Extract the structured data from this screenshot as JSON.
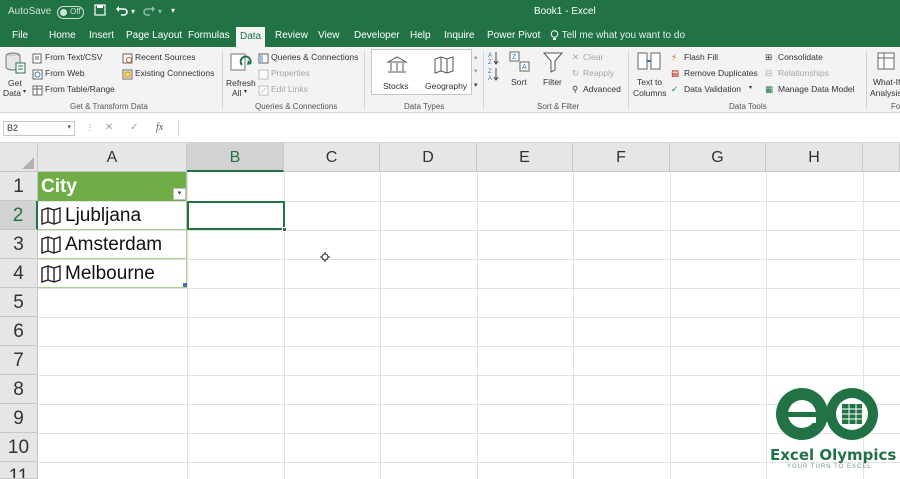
{
  "titlebar": {
    "autosave_label": "AutoSave",
    "autosave_state": "Off",
    "document_title": "Book1  -  Excel"
  },
  "ribbon_tabs": [
    "File",
    "Home",
    "Insert",
    "Page Layout",
    "Formulas",
    "Data",
    "Review",
    "View",
    "Developer",
    "Help",
    "Inquire",
    "Power Pivot"
  ],
  "active_tab": "Data",
  "tell_me": "Tell me what you want to do",
  "ribbon": {
    "get_data": "Get Data",
    "get_data_line1": "Get",
    "get_data_line2": "Data",
    "from_text_csv": "From Text/CSV",
    "from_web": "From Web",
    "from_table_range": "From Table/Range",
    "recent_sources": "Recent Sources",
    "existing_connections": "Existing Connections",
    "group_get_transform": "Get & Transform Data",
    "refresh_all_line1": "Refresh",
    "refresh_all_line2": "All",
    "queries_connections": "Queries & Connections",
    "properties": "Properties",
    "edit_links": "Edit Links",
    "group_queries": "Queries & Connections",
    "stocks": "Stocks",
    "geography": "Geography",
    "group_data_types": "Data Types",
    "sort": "Sort",
    "filter": "Filter",
    "clear": "Clear",
    "reapply": "Reapply",
    "advanced": "Advanced",
    "group_sort_filter": "Sort & Filter",
    "text_to_columns_line1": "Text to",
    "text_to_columns_line2": "Columns",
    "flash_fill": "Flash Fill",
    "remove_duplicates": "Remove Duplicates",
    "data_validation": "Data Validation",
    "consolidate": "Consolidate",
    "relationships": "Relationships",
    "manage_data_model": "Manage Data Model",
    "group_data_tools": "Data Tools",
    "what_if_line1": "What-If",
    "what_if_line2": "Analysis",
    "group_forecast": "Fo"
  },
  "formula_bar": {
    "name_box": "B2",
    "fx": "fx",
    "value": ""
  },
  "columns": [
    "A",
    "B",
    "C",
    "D",
    "E",
    "F",
    "G",
    "H"
  ],
  "rows": [
    "1",
    "2",
    "3",
    "4",
    "5",
    "6",
    "7",
    "8",
    "9",
    "10",
    "11"
  ],
  "table": {
    "header": "City",
    "cells": [
      "Ljubljana",
      "Amsterdam",
      "Melbourne"
    ]
  },
  "selected_cell": "B2",
  "logo": {
    "name": "Excel Olympics",
    "tagline": "YOUR TURN TO EXCEL"
  },
  "colors": {
    "excel_green": "#217346",
    "table_header": "#70ad47",
    "table_border": "#a9d08e"
  }
}
